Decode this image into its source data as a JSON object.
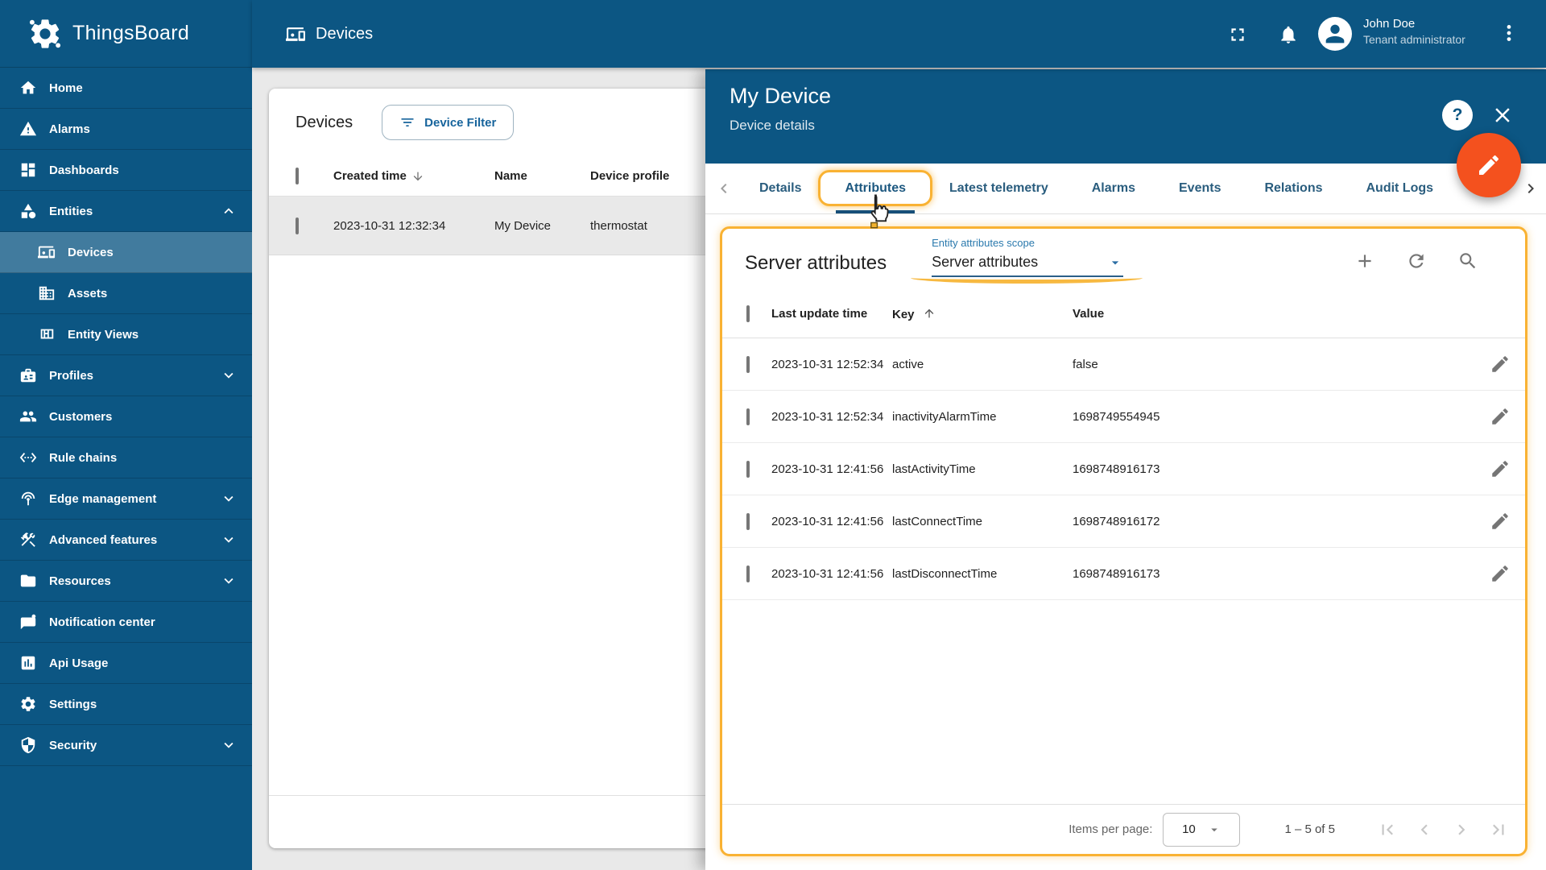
{
  "app": {
    "name": "ThingsBoard"
  },
  "colors": {
    "primary_blue": "#0c5683",
    "fab_orange": "#f4511e",
    "highlight_amber": "#f9b233",
    "link_blue": "#17649c"
  },
  "sidebar": {
    "items": [
      {
        "label": "Home"
      },
      {
        "label": "Alarms"
      },
      {
        "label": "Dashboards"
      },
      {
        "label": "Entities",
        "expanded": true
      },
      {
        "label": "Devices",
        "selected": true
      },
      {
        "label": "Assets"
      },
      {
        "label": "Entity Views"
      },
      {
        "label": "Profiles"
      },
      {
        "label": "Customers"
      },
      {
        "label": "Rule chains"
      },
      {
        "label": "Edge management"
      },
      {
        "label": "Advanced features"
      },
      {
        "label": "Resources"
      },
      {
        "label": "Notification center"
      },
      {
        "label": "Api Usage"
      },
      {
        "label": "Settings"
      },
      {
        "label": "Security"
      }
    ]
  },
  "toolbar": {
    "title": "Devices",
    "user": {
      "name": "John Doe",
      "role": "Tenant administrator"
    }
  },
  "devices_page": {
    "title": "Devices",
    "filter_button_label": "Device Filter",
    "table": {
      "columns": {
        "created": "Created time",
        "name": "Name",
        "profile": "Device profile"
      },
      "rows": [
        {
          "created_time": "2023-10-31 12:32:34",
          "name": "My Device",
          "profile": "thermostat",
          "highlighted": true
        }
      ]
    }
  },
  "panel": {
    "title": "My Device",
    "subtitle": "Device details",
    "active_tab": "Attributes",
    "tabs": [
      {
        "label": "Details"
      },
      {
        "label": "Attributes"
      },
      {
        "label": "Latest telemetry"
      },
      {
        "label": "Alarms"
      },
      {
        "label": "Events"
      },
      {
        "label": "Relations"
      },
      {
        "label": "Audit Logs"
      }
    ]
  },
  "attributes": {
    "heading": "Server attributes",
    "scope_label": "Entity attributes scope",
    "scope_value": "Server attributes",
    "columns": {
      "time": "Last update time",
      "key": "Key",
      "value": "Value"
    },
    "rows": [
      {
        "time": "2023-10-31 12:52:34",
        "key": "active",
        "value": "false"
      },
      {
        "time": "2023-10-31 12:52:34",
        "key": "inactivityAlarmTime",
        "value": "1698749554945"
      },
      {
        "time": "2023-10-31 12:41:56",
        "key": "lastActivityTime",
        "value": "1698748916173"
      },
      {
        "time": "2023-10-31 12:41:56",
        "key": "lastConnectTime",
        "value": "1698748916172"
      },
      {
        "time": "2023-10-31 12:41:56",
        "key": "lastDisconnectTime",
        "value": "1698748916173"
      }
    ],
    "pagination": {
      "items_per_page_label": "Items per page:",
      "items_per_page": "10",
      "range_label": "1 – 5 of 5"
    }
  }
}
